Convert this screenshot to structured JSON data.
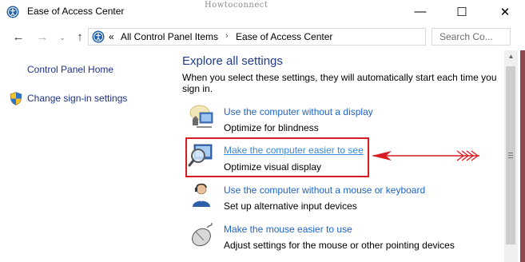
{
  "window": {
    "title": "Ease of Access Center",
    "watermark": "Howtoconnect",
    "minimize_glyph": "—",
    "maximize_glyph": "☐",
    "close_glyph": "✕"
  },
  "nav": {
    "back_glyph": "←",
    "forward_glyph": "→",
    "recent_glyph": "⌄",
    "up_glyph": "↑",
    "overflow": "«",
    "breadcrumb": [
      "All Control Panel Items",
      "Ease of Access Center"
    ],
    "separator": "›",
    "search_placeholder": "Search Co..."
  },
  "sidebar": {
    "items": [
      {
        "label": "Control Panel Home"
      },
      {
        "label": "Change sign-in settings",
        "icon": "shield-icon"
      }
    ]
  },
  "main": {
    "heading": "Explore all settings",
    "intro": "When you select these settings, they will automatically start each time you sign in.",
    "items": [
      {
        "link": "Use the computer without a display",
        "desc": "Optimize for blindness",
        "icon": "display-speaker-icon"
      },
      {
        "link": "Make the computer easier to see",
        "desc": "Optimize visual display",
        "icon": "magnifier-monitor-icon"
      },
      {
        "link": "Use the computer without a mouse or keyboard",
        "desc": "Set up alternative input devices",
        "icon": "person-headset-icon"
      },
      {
        "link": "Make the mouse easier to use",
        "desc": "Adjust settings for the mouse or other pointing devices",
        "icon": "mouse-icon"
      }
    ]
  },
  "colors": {
    "link": "#1e64c8",
    "heading": "#1e3d8f",
    "annotation": "#d81b21"
  }
}
